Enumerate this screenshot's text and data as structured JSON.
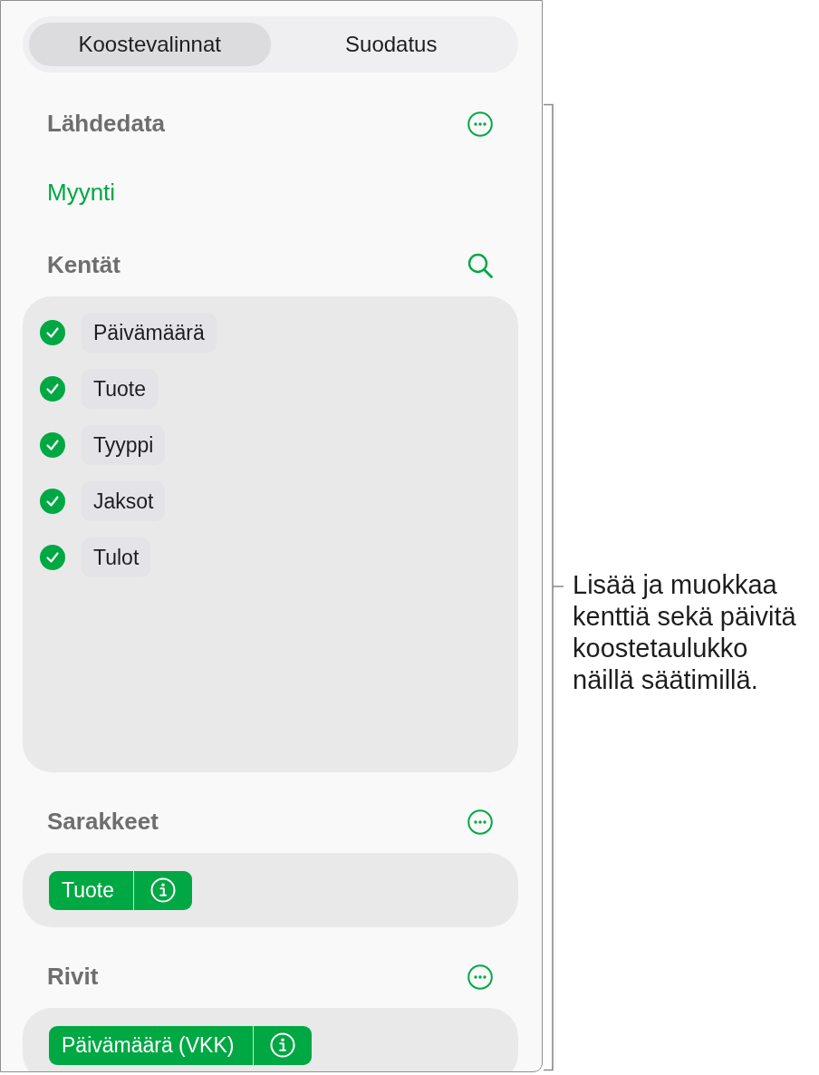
{
  "tabs": [
    {
      "label": "Koostevalinnat",
      "selected": true
    },
    {
      "label": "Suodatus",
      "selected": false
    }
  ],
  "sections": [
    {
      "kind": "source",
      "title": "Lähdedata",
      "value": "Myynti"
    },
    {
      "kind": "fields",
      "title": "Kentät",
      "items": [
        {
          "label": "Päivämäärä",
          "checked": true
        },
        {
          "label": "Tuote",
          "checked": true
        },
        {
          "label": "Tyyppi",
          "checked": true
        },
        {
          "label": "Jaksot",
          "checked": true
        },
        {
          "label": "Tulot",
          "checked": true
        }
      ]
    },
    {
      "kind": "chips",
      "title": "Sarakkeet",
      "chips": [
        "Tuote"
      ]
    },
    {
      "kind": "chips",
      "title": "Rivit",
      "chips": [
        "Päivämäärä (VKK)"
      ]
    }
  ],
  "callout": {
    "text": "Lisää ja muokkaa kenttiä sekä päivitä koostetaulukko näillä säätimillä."
  }
}
